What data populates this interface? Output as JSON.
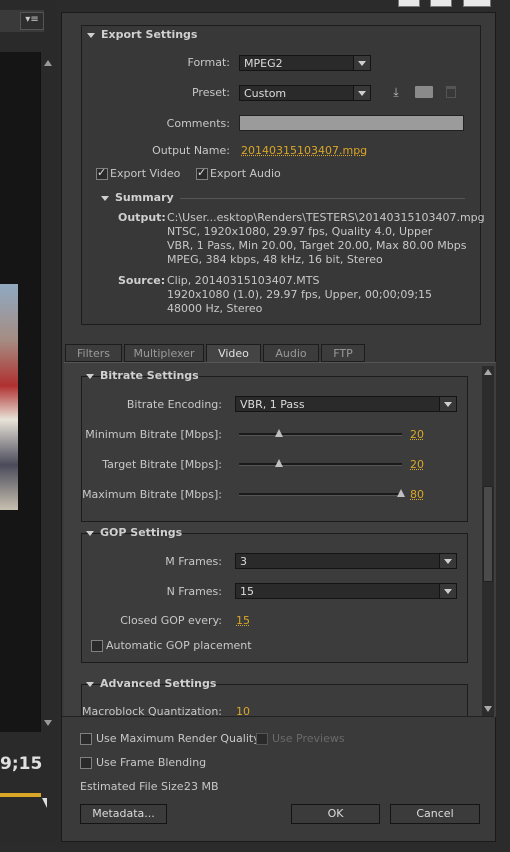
{
  "left_panel": {
    "timecode": "9;15"
  },
  "export_settings": {
    "title": "Export Settings",
    "format_label": "Format:",
    "format_value": "MPEG2",
    "preset_label": "Preset:",
    "preset_value": "Custom",
    "comments_label": "Comments:",
    "comments_value": "",
    "output_name_label": "Output Name:",
    "output_name_value": "20140315103407.mpg",
    "export_video_label": "Export Video",
    "export_audio_label": "Export Audio",
    "summary_title": "Summary",
    "output_label": "Output:",
    "output_lines": [
      "C:\\User...esktop\\Renders\\TESTERS\\20140315103407.mpg",
      "NTSC, 1920x1080, 29.97 fps, Quality 4.0, Upper",
      "VBR, 1 Pass, Min 20.00, Target 20.00, Max 80.00 Mbps",
      "MPEG, 384 kbps, 48 kHz, 16 bit, Stereo"
    ],
    "source_label": "Source:",
    "source_lines": [
      "Clip, 20140315103407.MTS",
      "1920x1080 (1.0), 29.97 fps, Upper, 00;00;09;15",
      "48000 Hz, Stereo"
    ]
  },
  "tabs": [
    "Filters",
    "Multiplexer",
    "Video",
    "Audio",
    "FTP"
  ],
  "bitrate": {
    "title": "Bitrate Settings",
    "encoding_label": "Bitrate Encoding:",
    "encoding_value": "VBR, 1 Pass",
    "min_label": "Minimum Bitrate [Mbps]:",
    "min_value": "20",
    "target_label": "Target Bitrate [Mbps]:",
    "target_value": "20",
    "max_label": "Maximum Bitrate [Mbps]:",
    "max_value": "80"
  },
  "gop": {
    "title": "GOP Settings",
    "m_label": "M Frames:",
    "m_value": "3",
    "n_label": "N Frames:",
    "n_value": "15",
    "closed_label": "Closed GOP every:",
    "closed_value": "15",
    "auto_label": "Automatic GOP placement"
  },
  "advanced": {
    "title": "Advanced Settings",
    "mbq_label": "Macroblock Quantization:",
    "mbq_value": "10"
  },
  "bottom": {
    "max_render_label": "Use Maximum Render Quality",
    "use_previews_label": "Use Previews",
    "frame_blending_label": "Use Frame Blending",
    "file_size_label": "Estimated File Size:",
    "file_size_value": "23 MB",
    "metadata_label": "Metadata...",
    "ok_label": "OK",
    "cancel_label": "Cancel"
  }
}
